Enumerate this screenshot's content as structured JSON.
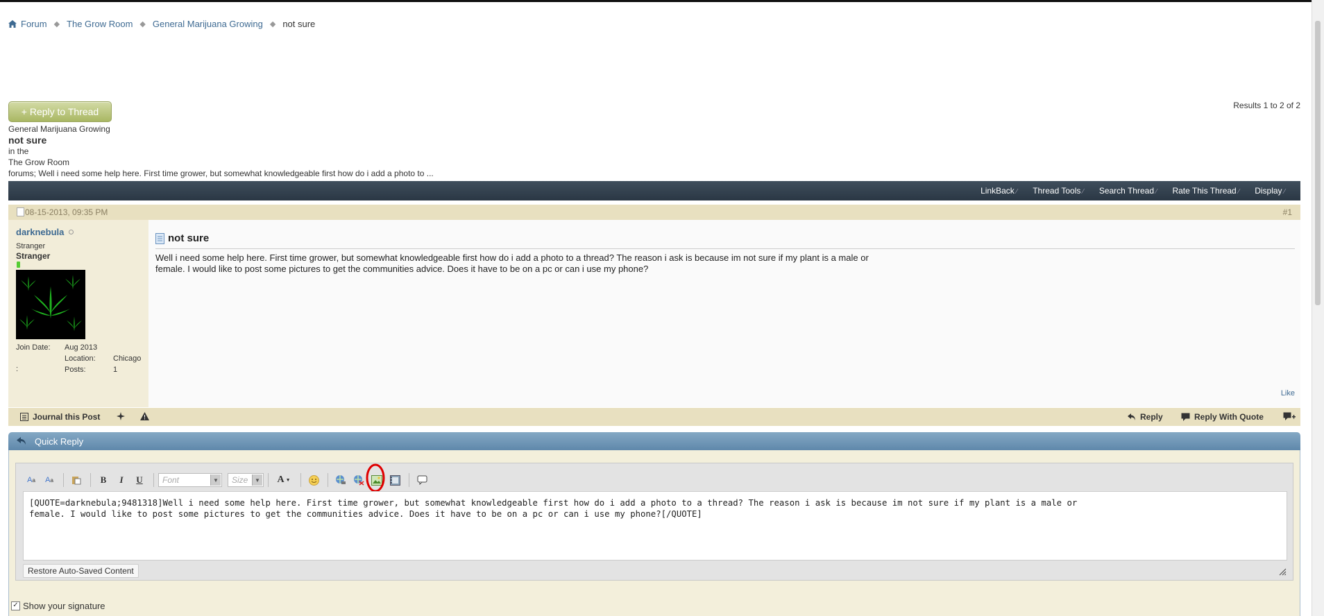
{
  "breadcrumb": {
    "items": [
      "Forum",
      "The Grow Room",
      "General Marijuana Growing"
    ],
    "current": "not sure"
  },
  "actions": {
    "reply_to_thread": "+ Reply to Thread"
  },
  "results": "Results 1 to 2 of 2",
  "thread_info": {
    "forum": "General Marijuana Growing",
    "title": "not sure",
    "in_the": "in the",
    "section": "The Grow Room",
    "summary": "forums; Well i need some help here. First time grower, but somewhat knowledgeable first how do i add a photo to ..."
  },
  "thread_toolbar": [
    "LinkBack",
    "Thread Tools",
    "Search Thread",
    "Rate This Thread",
    "Display"
  ],
  "post": {
    "date": "08-15-2013, 09:35 PM",
    "number": "#1",
    "username": "darknebula",
    "rank_title": "Stranger",
    "rank_label": "Stranger",
    "details": {
      "join_label": "Join Date:",
      "join_value": "Aug 2013",
      "location_label": "Location:",
      "location_value": "Chicago",
      "colon": ":",
      "posts_label": "Posts:",
      "posts_value": "1"
    },
    "title": "not sure",
    "body_line1": "Well i need some help here. First time grower, but somewhat knowledgeable first how do i add a photo to a thread? The reason i ask is because im not sure if my plant is a male or",
    "body_line2": "female. I would like to post some pictures to get the communities advice. Does it have to be on a pc or can i use my phone?",
    "like": "Like",
    "footer": {
      "journal": "Journal this Post",
      "reply": "Reply",
      "reply_with_quote": "Reply With Quote"
    }
  },
  "quick_reply": {
    "title": "Quick Reply",
    "font_placeholder": "Font",
    "size_placeholder": "Size",
    "editor_text": "[QUOTE=darknebula;9481318]Well i need some help here. First time grower, but somewhat knowledgeable first how do i add a photo to a thread? The reason i ask is because im not sure if my plant is a male or\nfemale. I would like to post some pictures to get the communities advice. Does it have to be on a pc or can i use my phone?[/QUOTE]",
    "restore": "Restore Auto-Saved Content",
    "show_signature": "Show your signature",
    "show_signature_checked": true
  },
  "colors": {
    "link": "#3e6a92",
    "toolbar_dark": "#2a3744",
    "post_band": "#e8e0c0",
    "quick_reply_header": "#5f88ab",
    "highlight_circle": "#e00000"
  },
  "icons": [
    "home-icon",
    "post-icon",
    "journal-icon",
    "star-icon",
    "warning-icon",
    "reply-icon",
    "quote-icon",
    "multiquote-icon",
    "quick-reply-icon",
    "insert-image-icon"
  ]
}
